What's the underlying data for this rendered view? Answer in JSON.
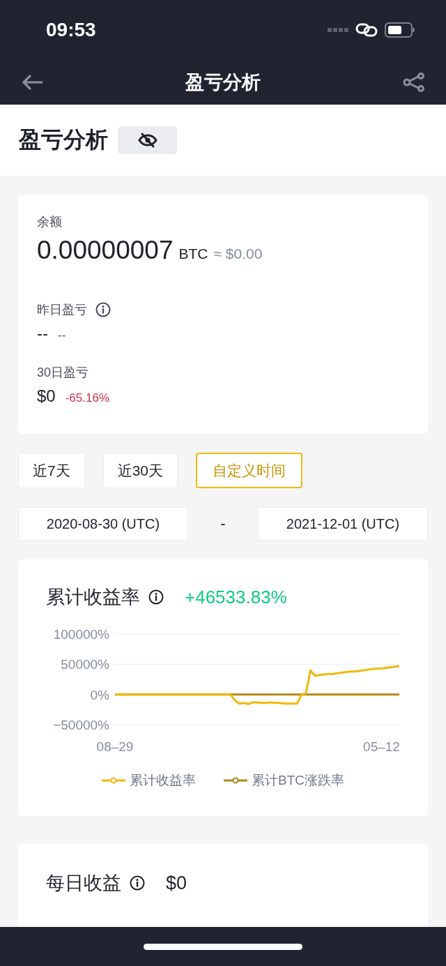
{
  "status_bar": {
    "time": "09:53"
  },
  "nav": {
    "title": "盈亏分析"
  },
  "header": {
    "title": "盈亏分析"
  },
  "summary": {
    "balance": {
      "label": "余额",
      "value": "0.00000007",
      "unit": "BTC",
      "approx": "≈ $0.00"
    },
    "yesterday": {
      "label": "昨日盈亏",
      "value": "--",
      "percent": "--"
    },
    "thirty_day": {
      "label": "30日盈亏",
      "value": "$0",
      "percent": "-65.16%"
    }
  },
  "range_tabs": [
    {
      "label": "近7天",
      "selected": false
    },
    {
      "label": "近30天",
      "selected": false
    },
    {
      "label": "自定义时间",
      "selected": true
    }
  ],
  "date_range": {
    "start": "2020-08-30 (UTC)",
    "separator": "-",
    "end": "2021-12-01 (UTC)"
  },
  "cumulative": {
    "title": "累计收益率",
    "value": "+46533.83%",
    "chart_data": {
      "type": "line",
      "categories": [
        "08–29",
        null,
        null,
        null,
        null,
        null,
        null,
        null,
        null,
        null,
        null,
        null,
        null,
        null,
        null,
        null,
        null,
        null,
        null,
        null,
        null,
        null,
        null,
        null,
        null,
        null,
        null,
        null,
        null,
        null,
        null,
        null,
        null,
        null,
        null,
        null,
        null,
        null,
        null,
        null,
        null,
        null,
        null,
        null,
        null,
        null,
        null,
        null,
        null,
        null,
        null,
        null,
        null,
        null,
        null,
        null,
        null,
        null,
        null,
        null,
        "05–12",
        null,
        null,
        null,
        null
      ],
      "legend": true,
      "series": [
        {
          "name": "累计收益率",
          "color": "#f0b90b",
          "values": [
            0,
            0,
            0,
            0,
            0,
            0,
            0,
            0,
            0,
            0,
            0,
            0,
            0,
            0,
            0,
            0,
            0,
            0,
            0,
            0,
            0,
            0,
            0,
            0,
            0,
            0,
            0,
            -10000,
            -15000,
            -14000,
            -16000,
            -13000,
            -13000,
            -14000,
            -14000,
            -13000,
            -14000,
            -14000,
            -15000,
            -15000,
            -15000,
            -15000,
            0,
            2000,
            40000,
            31000,
            32000,
            33000,
            34000,
            34000,
            35000,
            36000,
            37000,
            38000,
            38000,
            39000,
            40000,
            41000,
            42000,
            43000,
            43000,
            44000,
            45000,
            46000,
            47000
          ]
        },
        {
          "name": "累计BTC涨跌率",
          "color": "#b08a16",
          "values": [
            0,
            0,
            0,
            0,
            0,
            0,
            0,
            0,
            0,
            0,
            0,
            0,
            0,
            0,
            0,
            0,
            0,
            0,
            0,
            0,
            0,
            0,
            0,
            0,
            0,
            0,
            0,
            0,
            0,
            0,
            0,
            0,
            0,
            0,
            0,
            0,
            0,
            0,
            0,
            0,
            0,
            0,
            0,
            0,
            0,
            0,
            0,
            0,
            0,
            0,
            0,
            0,
            0,
            0,
            0,
            0,
            0,
            0,
            0,
            0,
            0,
            0,
            0,
            0,
            0
          ]
        }
      ],
      "ylim": [
        -50000,
        100000
      ],
      "yticks": [
        {
          "value": -50000,
          "label": "−50000%"
        },
        {
          "value": 0,
          "label": "0%"
        },
        {
          "value": 50000,
          "label": "50000%"
        },
        {
          "value": 100000,
          "label": "100000%"
        }
      ]
    }
  },
  "daily": {
    "title": "每日收益",
    "value": "$0"
  }
}
